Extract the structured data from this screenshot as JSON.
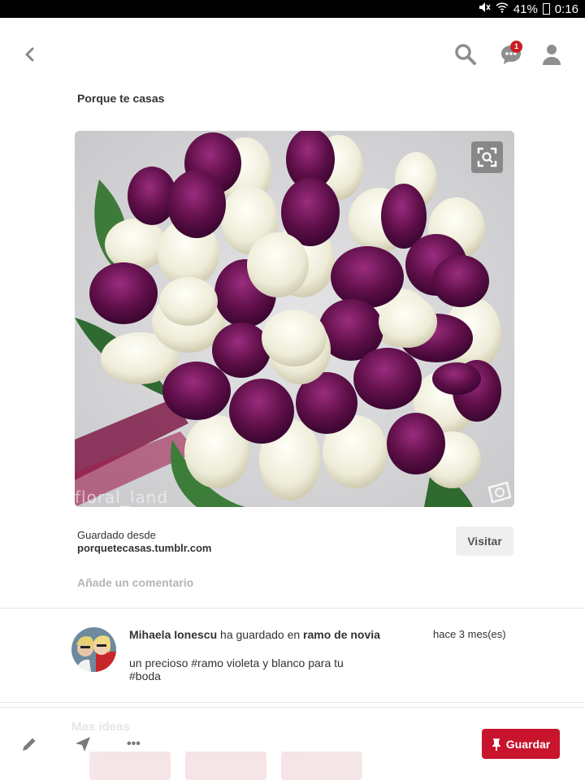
{
  "status_bar": {
    "battery": "41%",
    "time": "0:16"
  },
  "header": {
    "notification_count": "1"
  },
  "pin": {
    "board_title": "Porque te casas",
    "watermark": "floral_land",
    "saved_from_label": "Guardado desde",
    "source": "porquetecasas.tumblr.com",
    "visit_label": "Visitar",
    "comment_placeholder": "Añade un comentario"
  },
  "activity": {
    "user": "Mihaela Ionescu",
    "action": "ha guardado en",
    "board": "ramo de novia",
    "description": "un precioso #ramo violeta y blanco para tu #boda",
    "time": "hace 3 mes(es)"
  },
  "bottom_bar": {
    "save_label": "Guardar",
    "more_label": "•••",
    "faded_text": "Mas ideas"
  }
}
